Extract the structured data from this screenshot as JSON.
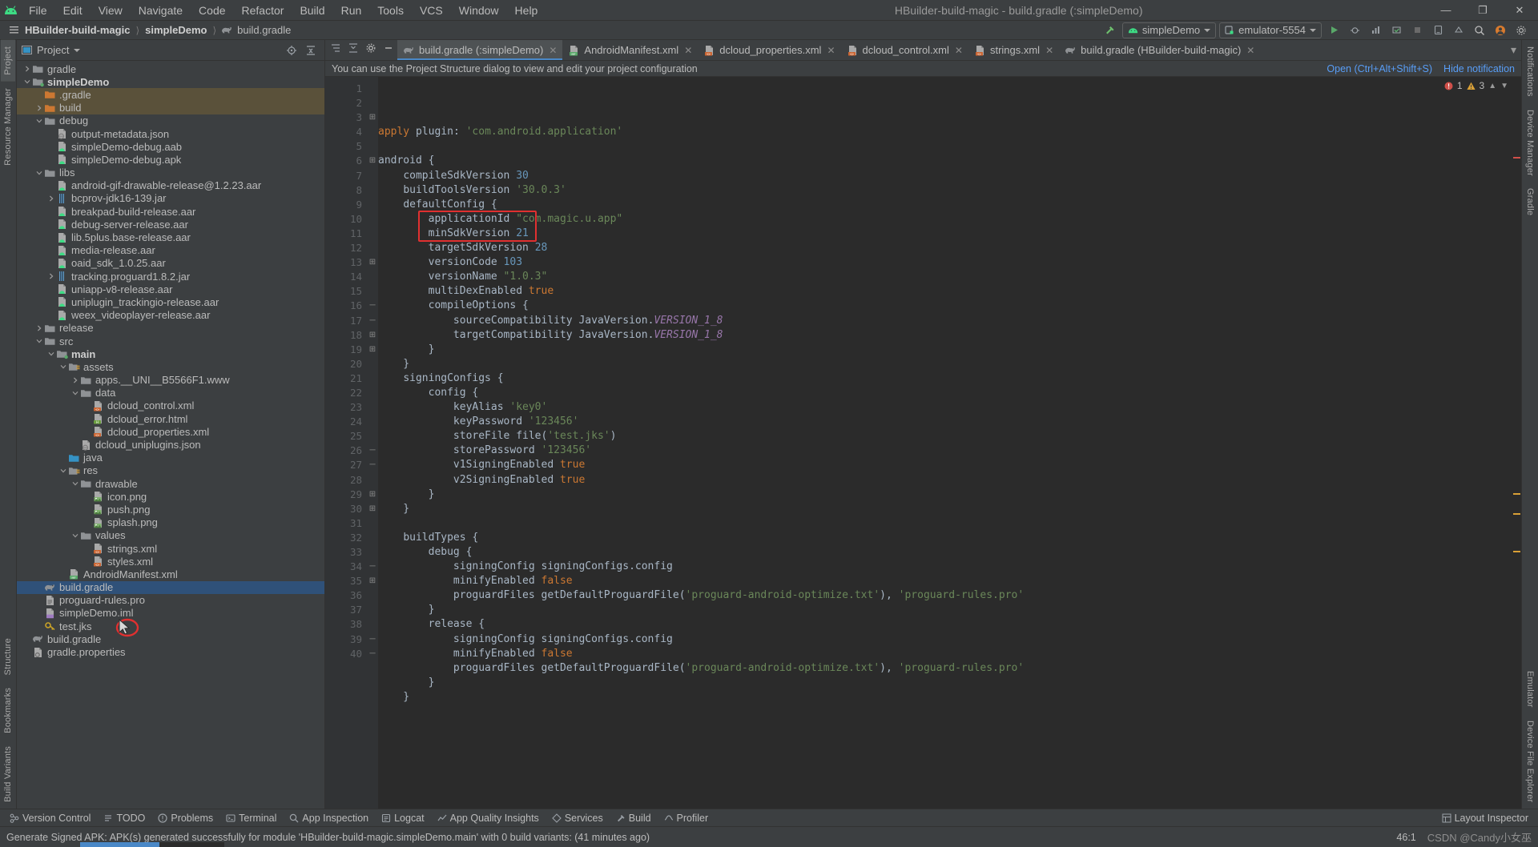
{
  "window": {
    "title": "HBuilder-build-magic - build.gradle (:simpleDemo)",
    "minimize": "—",
    "maximize": "❐",
    "close": "✕"
  },
  "menu": [
    "File",
    "Edit",
    "View",
    "Navigate",
    "Code",
    "Refactor",
    "Build",
    "Run",
    "Tools",
    "VCS",
    "Window",
    "Help"
  ],
  "breadcrumb": {
    "project": "HBuilder-build-magic",
    "module": "simpleDemo",
    "file": "build.gradle"
  },
  "toolbar": {
    "run_config": "simpleDemo",
    "device": "emulator-5554"
  },
  "project_panel": {
    "title": "Project",
    "tree": [
      {
        "depth": 1,
        "arrow": "collapsed",
        "icon": "folder",
        "label": "gradle",
        "bold": false,
        "state": "normal"
      },
      {
        "depth": 1,
        "arrow": "expanded",
        "icon": "module",
        "label": "simpleDemo",
        "bold": true,
        "state": "normal"
      },
      {
        "depth": 2,
        "arrow": "none",
        "icon": "folder-orange",
        "label": ".gradle",
        "bold": false,
        "state": "hl"
      },
      {
        "depth": 2,
        "arrow": "collapsed",
        "icon": "folder-orange",
        "label": "build",
        "bold": false,
        "state": "hl"
      },
      {
        "depth": 2,
        "arrow": "expanded",
        "icon": "folder",
        "label": "debug",
        "bold": false,
        "state": "normal"
      },
      {
        "depth": 3,
        "arrow": "none",
        "icon": "json",
        "label": "output-metadata.json",
        "bold": false,
        "state": "normal"
      },
      {
        "depth": 3,
        "arrow": "none",
        "icon": "android-file",
        "label": "simpleDemo-debug.aab",
        "bold": false,
        "state": "normal"
      },
      {
        "depth": 3,
        "arrow": "none",
        "icon": "android-file",
        "label": "simpleDemo-debug.apk",
        "bold": false,
        "state": "normal"
      },
      {
        "depth": 2,
        "arrow": "expanded",
        "icon": "folder",
        "label": "libs",
        "bold": false,
        "state": "normal"
      },
      {
        "depth": 3,
        "arrow": "none",
        "icon": "android-file",
        "label": "android-gif-drawable-release@1.2.23.aar",
        "bold": false,
        "state": "normal"
      },
      {
        "depth": 3,
        "arrow": "collapsed",
        "icon": "jar",
        "label": "bcprov-jdk16-139.jar",
        "bold": false,
        "state": "normal"
      },
      {
        "depth": 3,
        "arrow": "none",
        "icon": "android-file",
        "label": "breakpad-build-release.aar",
        "bold": false,
        "state": "normal"
      },
      {
        "depth": 3,
        "arrow": "none",
        "icon": "android-file",
        "label": "debug-server-release.aar",
        "bold": false,
        "state": "normal"
      },
      {
        "depth": 3,
        "arrow": "none",
        "icon": "android-file",
        "label": "lib.5plus.base-release.aar",
        "bold": false,
        "state": "normal"
      },
      {
        "depth": 3,
        "arrow": "none",
        "icon": "android-file",
        "label": "media-release.aar",
        "bold": false,
        "state": "normal"
      },
      {
        "depth": 3,
        "arrow": "none",
        "icon": "android-file",
        "label": "oaid_sdk_1.0.25.aar",
        "bold": false,
        "state": "normal"
      },
      {
        "depth": 3,
        "arrow": "collapsed",
        "icon": "jar",
        "label": "tracking.proguard1.8.2.jar",
        "bold": false,
        "state": "normal"
      },
      {
        "depth": 3,
        "arrow": "none",
        "icon": "android-file",
        "label": "uniapp-v8-release.aar",
        "bold": false,
        "state": "normal"
      },
      {
        "depth": 3,
        "arrow": "none",
        "icon": "android-file",
        "label": "uniplugin_trackingio-release.aar",
        "bold": false,
        "state": "normal"
      },
      {
        "depth": 3,
        "arrow": "none",
        "icon": "android-file",
        "label": "weex_videoplayer-release.aar",
        "bold": false,
        "state": "normal"
      },
      {
        "depth": 2,
        "arrow": "collapsed",
        "icon": "folder",
        "label": "release",
        "bold": false,
        "state": "normal"
      },
      {
        "depth": 2,
        "arrow": "expanded",
        "icon": "folder",
        "label": "src",
        "bold": false,
        "state": "normal"
      },
      {
        "depth": 3,
        "arrow": "expanded",
        "icon": "module",
        "label": "main",
        "bold": true,
        "state": "normal"
      },
      {
        "depth": 4,
        "arrow": "expanded",
        "icon": "assets",
        "label": "assets",
        "bold": false,
        "state": "normal"
      },
      {
        "depth": 5,
        "arrow": "collapsed",
        "icon": "folder",
        "label": "apps.__UNI__B5566F1.www",
        "bold": false,
        "state": "normal"
      },
      {
        "depth": 5,
        "arrow": "expanded",
        "icon": "folder",
        "label": "data",
        "bold": false,
        "state": "normal"
      },
      {
        "depth": 6,
        "arrow": "none",
        "icon": "xml",
        "label": "dcloud_control.xml",
        "bold": false,
        "state": "normal"
      },
      {
        "depth": 6,
        "arrow": "none",
        "icon": "html",
        "label": "dcloud_error.html",
        "bold": false,
        "state": "normal"
      },
      {
        "depth": 6,
        "arrow": "none",
        "icon": "xml",
        "label": "dcloud_properties.xml",
        "bold": false,
        "state": "normal"
      },
      {
        "depth": 5,
        "arrow": "none",
        "icon": "json",
        "label": "dcloud_uniplugins.json",
        "bold": false,
        "state": "normal"
      },
      {
        "depth": 4,
        "arrow": "none",
        "icon": "folder-blue",
        "label": "java",
        "bold": false,
        "state": "normal"
      },
      {
        "depth": 4,
        "arrow": "expanded",
        "icon": "res",
        "label": "res",
        "bold": false,
        "state": "normal"
      },
      {
        "depth": 5,
        "arrow": "expanded",
        "icon": "folder",
        "label": "drawable",
        "bold": false,
        "state": "normal"
      },
      {
        "depth": 6,
        "arrow": "none",
        "icon": "image",
        "label": "icon.png",
        "bold": false,
        "state": "normal"
      },
      {
        "depth": 6,
        "arrow": "none",
        "icon": "image",
        "label": "push.png",
        "bold": false,
        "state": "normal"
      },
      {
        "depth": 6,
        "arrow": "none",
        "icon": "image",
        "label": "splash.png",
        "bold": false,
        "state": "normal"
      },
      {
        "depth": 5,
        "arrow": "expanded",
        "icon": "folder",
        "label": "values",
        "bold": false,
        "state": "normal"
      },
      {
        "depth": 6,
        "arrow": "none",
        "icon": "xml",
        "label": "strings.xml",
        "bold": false,
        "state": "normal"
      },
      {
        "depth": 6,
        "arrow": "none",
        "icon": "xml",
        "label": "styles.xml",
        "bold": false,
        "state": "normal"
      },
      {
        "depth": 4,
        "arrow": "none",
        "icon": "manifest",
        "label": "AndroidManifest.xml",
        "bold": false,
        "state": "normal"
      },
      {
        "depth": 2,
        "arrow": "none",
        "icon": "gradle",
        "label": "build.gradle",
        "bold": false,
        "state": "selected"
      },
      {
        "depth": 2,
        "arrow": "none",
        "icon": "text",
        "label": "proguard-rules.pro",
        "bold": false,
        "state": "normal"
      },
      {
        "depth": 2,
        "arrow": "none",
        "icon": "iml",
        "label": "simpleDemo.iml",
        "bold": false,
        "state": "normal"
      },
      {
        "depth": 2,
        "arrow": "none",
        "icon": "key",
        "label": "test.jks",
        "bold": false,
        "state": "normal"
      },
      {
        "depth": 1,
        "arrow": "none",
        "icon": "gradle",
        "label": "build.gradle",
        "bold": false,
        "state": "normal"
      },
      {
        "depth": 1,
        "arrow": "none",
        "icon": "props",
        "label": "gradle.properties",
        "bold": false,
        "state": "normal"
      }
    ]
  },
  "editor": {
    "tabs": [
      {
        "label": "build.gradle (:simpleDemo)",
        "icon": "gradle",
        "active": true
      },
      {
        "label": "AndroidManifest.xml",
        "icon": "manifest",
        "active": false
      },
      {
        "label": "dcloud_properties.xml",
        "icon": "xml",
        "active": false
      },
      {
        "label": "dcloud_control.xml",
        "icon": "xml",
        "active": false
      },
      {
        "label": "strings.xml",
        "icon": "xml",
        "active": false
      },
      {
        "label": "build.gradle (HBuilder-build-magic)",
        "icon": "gradle",
        "active": false
      }
    ],
    "notification": {
      "text": "You can use the Project Structure dialog to view and edit your project configuration",
      "action_open": "Open (Ctrl+Alt+Shift+S)",
      "action_hide": "Hide notification"
    },
    "inspection": {
      "errors": "1",
      "warnings": "3"
    },
    "first_line": 1,
    "last_line": 40,
    "lines": [
      {
        "n": 1,
        "fold": "",
        "html": "<span class=\"kw\">apply</span> <span class=\"id\">plugin</span>: <span class=\"str\">'com.android.application'</span>"
      },
      {
        "n": 2,
        "fold": "",
        "html": ""
      },
      {
        "n": 3,
        "fold": "open",
        "html": "<span class=\"id\">android</span> {"
      },
      {
        "n": 4,
        "fold": "",
        "html": "    <span class=\"id\">compileSdkVersion</span> <span class=\"num\">30</span>"
      },
      {
        "n": 5,
        "fold": "",
        "html": "    <span class=\"id\">buildToolsVersion</span> <span class=\"str\">'30.0.3'</span>"
      },
      {
        "n": 6,
        "fold": "open",
        "html": "    <span class=\"id\">defaultConfig</span> {"
      },
      {
        "n": 7,
        "fold": "",
        "html": "        <span class=\"id\">applicationId</span> <span class=\"str\">\"com.magic.u.app\"</span>"
      },
      {
        "n": 8,
        "fold": "",
        "html": "        <span class=\"id\">minSdkVersion</span> <span class=\"num\">21</span>"
      },
      {
        "n": 9,
        "fold": "",
        "html": "        <span class=\"id\">targetSdkVersion</span> <span class=\"num\">28</span>"
      },
      {
        "n": 10,
        "fold": "",
        "html": "        <span class=\"id\">versionCode</span> <span class=\"num\">103</span>"
      },
      {
        "n": 11,
        "fold": "",
        "html": "        <span class=\"id\">versionName</span> <span class=\"str\">\"1.0.3\"</span>"
      },
      {
        "n": 12,
        "fold": "",
        "html": "        <span class=\"id\">multiDexEnabled</span> <span class=\"kw\">true</span>"
      },
      {
        "n": 13,
        "fold": "open",
        "html": "        <span class=\"id\">compileOptions</span> {"
      },
      {
        "n": 14,
        "fold": "",
        "html": "            <span class=\"id\">sourceCompatibility</span> <span class=\"id\">JavaVersion</span>.<span class=\"italic\">VERSION_1_8</span>"
      },
      {
        "n": 15,
        "fold": "",
        "html": "            <span class=\"id\">targetCompatibility</span> <span class=\"id\">JavaVersion</span>.<span class=\"italic\">VERSION_1_8</span>"
      },
      {
        "n": 16,
        "fold": "close",
        "html": "        }"
      },
      {
        "n": 17,
        "fold": "close",
        "html": "    }"
      },
      {
        "n": 18,
        "fold": "open",
        "html": "    <span class=\"id\">signingConfigs</span> {"
      },
      {
        "n": 19,
        "fold": "open",
        "html": "        <span class=\"id\">config</span> {"
      },
      {
        "n": 20,
        "fold": "",
        "html": "            <span class=\"id\">keyAlias</span> <span class=\"str\">'key0'</span>"
      },
      {
        "n": 21,
        "fold": "",
        "html": "            <span class=\"id\">keyPassword</span> <span class=\"str\">'123456'</span>"
      },
      {
        "n": 22,
        "fold": "",
        "html": "            <span class=\"id\">storeFile</span> <span class=\"id\">file</span>(<span class=\"str\">'test.jks'</span>)"
      },
      {
        "n": 23,
        "fold": "",
        "html": "            <span class=\"id\">storePassword</span> <span class=\"str\">'123456'</span>"
      },
      {
        "n": 24,
        "fold": "",
        "html": "            <span class=\"id\">v1SigningEnabled</span> <span class=\"kw\">true</span>"
      },
      {
        "n": 25,
        "fold": "",
        "html": "            <span class=\"id\">v2SigningEnabled</span> <span class=\"kw\">true</span>"
      },
      {
        "n": 26,
        "fold": "close",
        "html": "        }"
      },
      {
        "n": 27,
        "fold": "close",
        "html": "    }"
      },
      {
        "n": 28,
        "fold": "",
        "html": ""
      },
      {
        "n": 29,
        "fold": "open",
        "html": "    <span class=\"id\">buildTypes</span> {"
      },
      {
        "n": 30,
        "fold": "open",
        "html": "        <span class=\"id\">debug</span> {"
      },
      {
        "n": 31,
        "fold": "",
        "html": "            <span class=\"id\">signingConfig</span> <span class=\"id\">signingConfigs</span>.<span class=\"id\">config</span>"
      },
      {
        "n": 32,
        "fold": "",
        "html": "            <span class=\"id\">minifyEnabled</span> <span class=\"kw\">false</span>"
      },
      {
        "n": 33,
        "fold": "",
        "html": "            <span class=\"id\">proguardFiles</span> <span class=\"id\">getDefaultProguardFile</span>(<span class=\"str\">'proguard-android-optimize.txt'</span>), <span class=\"str\">'proguard-rules.pro'</span>"
      },
      {
        "n": 34,
        "fold": "close",
        "html": "        }"
      },
      {
        "n": 35,
        "fold": "open",
        "html": "        <span class=\"id\">release</span> {"
      },
      {
        "n": 36,
        "fold": "",
        "html": "            <span class=\"id\">signingConfig</span> <span class=\"id\">signingConfigs</span>.<span class=\"id\">config</span>"
      },
      {
        "n": 37,
        "fold": "",
        "html": "            <span class=\"id\">minifyEnabled</span> <span class=\"kw\">false</span>"
      },
      {
        "n": 38,
        "fold": "",
        "html": "            <span class=\"id\">proguardFiles</span> <span class=\"id\">getDefaultProguardFile</span>(<span class=\"str\">'proguard-android-optimize.txt'</span>), <span class=\"str\">'proguard-rules.pro'</span>"
      },
      {
        "n": 39,
        "fold": "close",
        "html": "        }"
      },
      {
        "n": 40,
        "fold": "close",
        "html": "    }"
      }
    ],
    "annotation": {
      "color": "#e03030",
      "note": "red rectangle around versionCode / versionName lines"
    }
  },
  "left_rail": [
    "Project",
    "Resource Manager"
  ],
  "left_rail_bottom": [
    "Structure",
    "Bookmarks",
    "Build Variants"
  ],
  "right_rail": [
    "Notifications",
    "Device Manager",
    "Gradle"
  ],
  "right_rail_bottom": [
    "Emulator",
    "Device File Explorer"
  ],
  "bottom_bar": {
    "items": [
      {
        "label": "Version Control",
        "icon": "vcs-icon"
      },
      {
        "label": "TODO",
        "icon": "todo-icon"
      },
      {
        "label": "Problems",
        "icon": "problems-icon"
      },
      {
        "label": "Terminal",
        "icon": "terminal-icon"
      },
      {
        "label": "App Inspection",
        "icon": "inspection-icon"
      },
      {
        "label": "Logcat",
        "icon": "logcat-icon"
      },
      {
        "label": "App Quality Insights",
        "icon": "insights-icon"
      },
      {
        "label": "Services",
        "icon": "services-icon"
      },
      {
        "label": "Build",
        "icon": "build-icon"
      },
      {
        "label": "Profiler",
        "icon": "profiler-icon"
      }
    ],
    "right_label": "Layout Inspector"
  },
  "status_bar": {
    "message": "Generate Signed APK: APK(s) generated successfully for module 'HBuilder-build-magic.simpleDemo.main' with 0 build variants: (41 minutes ago)",
    "caret": "46:1",
    "watermark": "CSDN @Candy小女巫"
  }
}
